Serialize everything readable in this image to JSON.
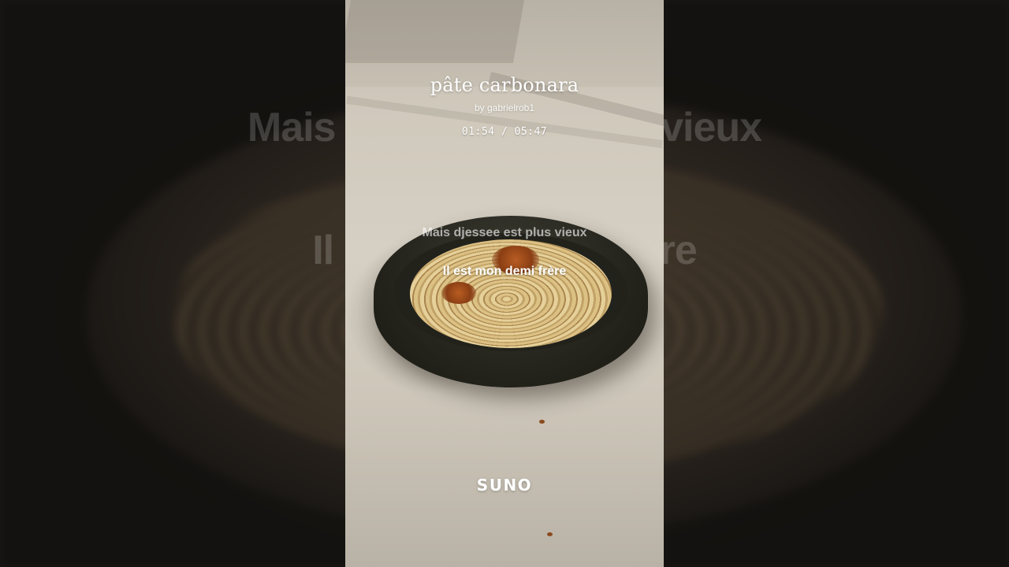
{
  "background": {
    "lyric_line_1": "Mais djessee est plus vieux",
    "lyric_line_2": "Il est mon demi frère"
  },
  "track": {
    "title": "pâte carbonara",
    "artist": "by gabrielrob1",
    "time_display": "01:54 / 05:47"
  },
  "lyrics": {
    "previous": "Mais djessee est plus vieux",
    "current": "Il est mon demi frère"
  },
  "brand": {
    "logo_text": "SUNO"
  },
  "colors": {
    "text": "#ffffff",
    "backdrop": "#1a1816"
  }
}
